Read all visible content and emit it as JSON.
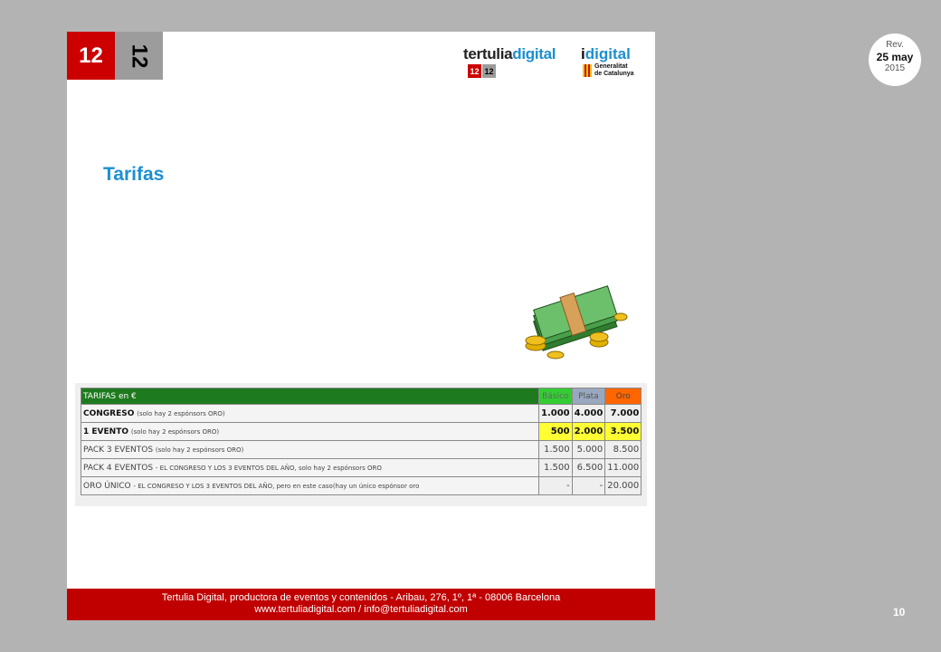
{
  "header": {
    "logo_left": "12",
    "logo_right": "12",
    "brand_part1": "tertulia",
    "brand_part2": "digital",
    "mini_logo_a": "12",
    "mini_logo_b": "12",
    "idigital_prefix": "i",
    "idigital_word": "digital",
    "gen_line1": "Generalitat",
    "gen_line2": "de Catalunya"
  },
  "title": "Tarifas",
  "money_icon": "money-stack-icon",
  "table": {
    "header": {
      "label": "TARIFAS en €",
      "basico": "Básico",
      "plata": "Plata",
      "oro": "Oro"
    },
    "rows": [
      {
        "name": "CONGRESO",
        "note": "(solo hay 2 espónsors ORO)",
        "basico": "1.000",
        "plata": "4.000",
        "oro": "7.000"
      },
      {
        "name": "1 EVENTO",
        "note": "(solo hay 2 espónsors ORO)",
        "basico": "500",
        "plata": "2.000",
        "oro": "3.500"
      },
      {
        "name": "PACK 3 EVENTOS",
        "note": "(solo hay 2 espónsors ORO)",
        "basico": "1.500",
        "plata": "5.000",
        "oro": "8.500"
      },
      {
        "name": "PACK 4 EVENTOS",
        "note": "- EL CONGRESO Y LOS 3 EVENTOS DEL AÑO, solo hay 2 espónsors ORO",
        "basico": "1.500",
        "plata": "6.500",
        "oro": "11.000"
      },
      {
        "name": "ORO ÚNICO",
        "note": "- EL CONGRESO Y LOS 3 EVENTOS DEL AÑO, pero en este caso(hay un único espónsor oro",
        "basico": "-",
        "plata": "-",
        "oro": "20.000"
      }
    ]
  },
  "footer": {
    "line1": "Tertulia Digital, productora de eventos y contenidos - Aribau, 276, 1º, 1ª  - 08006 Barcelona",
    "line2": "www.tertuliadigital.com / info@tertuliadigital.com"
  },
  "rev": {
    "label": "Rev.",
    "date": "25 may",
    "year": "2015"
  },
  "page_number": "10"
}
